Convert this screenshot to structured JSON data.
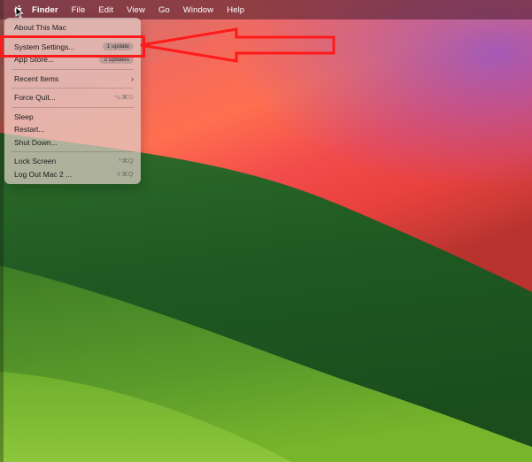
{
  "menubar": {
    "apple_icon": "apple-logo-icon",
    "items": [
      "Finder",
      "File",
      "Edit",
      "View",
      "Go",
      "Window",
      "Help"
    ]
  },
  "apple_menu": {
    "about": "About This Mac",
    "system_settings": "System Settings...",
    "system_settings_badge": "1 update",
    "app_store": "App Store...",
    "app_store_badge": "2 updates",
    "recent_items": "Recent Items",
    "force_quit": "Force Quit...",
    "force_quit_shortcut": "⌥⌘⎋",
    "sleep": "Sleep",
    "restart": "Restart...",
    "shut_down": "Shut Down...",
    "lock_screen": "Lock Screen",
    "lock_screen_shortcut": "^⌘Q",
    "log_out": "Log Out Mac 2 ...",
    "log_out_shortcut": "⇧⌘Q"
  },
  "annotation": {
    "color": "#ff1a1a",
    "target": "System Settings..."
  }
}
